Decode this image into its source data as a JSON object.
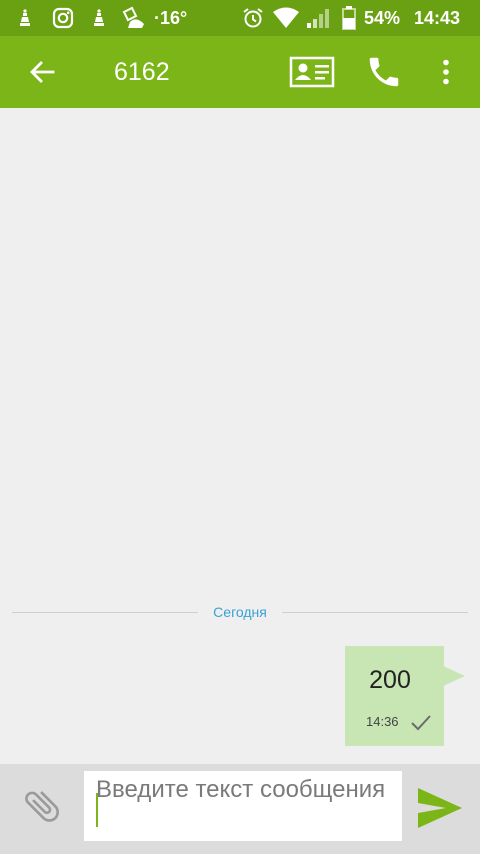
{
  "status_bar": {
    "temperature": "·16°",
    "battery": "54%",
    "time": "14:43",
    "icons": [
      "notification-app-icon",
      "instagram-icon",
      "notification-app-icon",
      "weather-notification-icon",
      "alarm-icon",
      "wifi-icon",
      "signal-icon",
      "battery-icon"
    ]
  },
  "app_bar": {
    "title": "6162",
    "icons": [
      "back-arrow-icon",
      "contact-card-icon",
      "phone-icon",
      "more-vert-icon"
    ]
  },
  "conversation": {
    "date_separator": "Сегодня",
    "messages": [
      {
        "text": "200",
        "time": "14:36",
        "status_icon": "checkmark-icon"
      }
    ]
  },
  "composer": {
    "placeholder": "Введите текст сообщения",
    "icons": [
      "paperclip-icon",
      "send-icon"
    ]
  },
  "colors": {
    "status_bar": "#6aa112",
    "app_bar": "#7cb518",
    "bubble": "#c7e6b4",
    "date_label": "#3aa1d4",
    "send": "#7cb518",
    "background": "#efefef"
  }
}
